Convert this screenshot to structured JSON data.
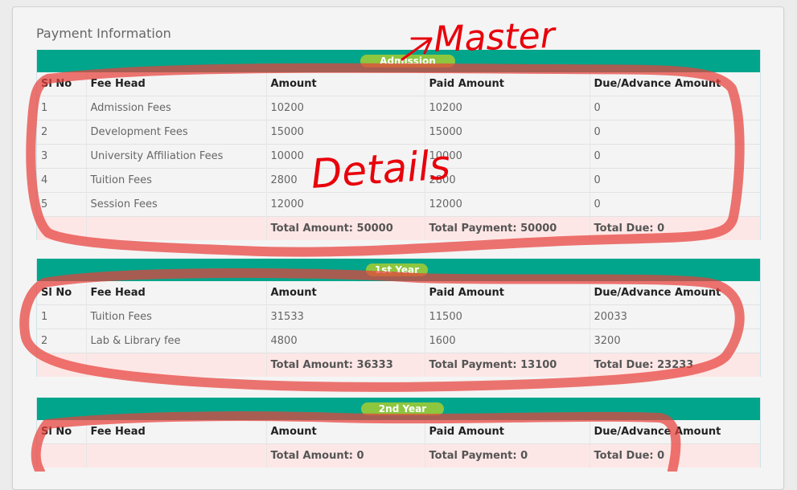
{
  "panel": {
    "title": "Payment Information"
  },
  "columns": [
    "Sl No",
    "Fee Head",
    "Amount",
    "Paid Amount",
    "Due/Advance Amount"
  ],
  "sections": [
    {
      "label": "Admission",
      "rows": [
        [
          "1",
          "Admission Fees",
          "10200",
          "10200",
          "0"
        ],
        [
          "2",
          "Development Fees",
          "15000",
          "15000",
          "0"
        ],
        [
          "3",
          "University Affiliation Fees",
          "10000",
          "10000",
          "0"
        ],
        [
          "4",
          "Tuition Fees",
          "2800",
          "2800",
          "0"
        ],
        [
          "5",
          "Session Fees",
          "12000",
          "12000",
          "0"
        ]
      ],
      "total_amount": "Total Amount: 50000",
      "total_payment": "Total Payment: 50000",
      "total_due": "Total Due: 0"
    },
    {
      "label": "1st Year",
      "rows": [
        [
          "1",
          "Tuition Fees",
          "31533",
          "11500",
          "20033"
        ],
        [
          "2",
          "Lab & Library fee",
          "4800",
          "1600",
          "3200"
        ]
      ],
      "total_amount": "Total Amount: 36333",
      "total_payment": "Total Payment: 13100",
      "total_due": "Total Due: 23233"
    },
    {
      "label": "2nd Year",
      "rows": [],
      "total_amount": "Total Amount: 0",
      "total_payment": "Total Payment: 0",
      "total_due": "Total Due: 0"
    }
  ],
  "annotations": {
    "master": "Master",
    "details": "Details"
  },
  "colors": {
    "header_bar": "#00a58b",
    "badge": "#8dc63f",
    "total_row": "#fde7e6",
    "annotation": "#e8413c"
  }
}
